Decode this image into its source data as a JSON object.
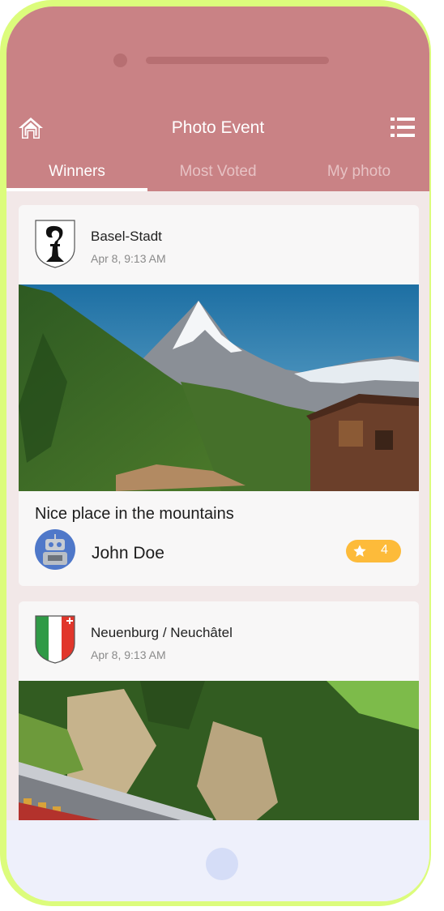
{
  "header": {
    "title": "Photo Event",
    "left_icon": "home-icon",
    "right_icon": "menu-list-icon"
  },
  "tabs": [
    {
      "label": "Winners",
      "active": true
    },
    {
      "label": "Most Voted",
      "active": false
    },
    {
      "label": "My photo",
      "active": false
    }
  ],
  "posts": [
    {
      "region": "Basel-Stadt",
      "timestamp": "Apr 8, 9:13 AM",
      "crest": "basel-stadt-crest-icon",
      "photo": "matterhorn-mountain-village-photo",
      "caption": "Nice place in the mountains",
      "author": "John Doe",
      "avatar": "robot-avatar-icon",
      "votes": "4"
    },
    {
      "region": "Neuenburg / Neuchâtel",
      "timestamp": "Apr 8, 9:13 AM",
      "crest": "neuchatel-crest-icon",
      "photo": "mountain-train-forest-photo"
    }
  ],
  "colors": {
    "header": "#c98285",
    "frame": "#dcfc7c",
    "badge": "#fdbb3a",
    "background": "#f2e8e8"
  }
}
